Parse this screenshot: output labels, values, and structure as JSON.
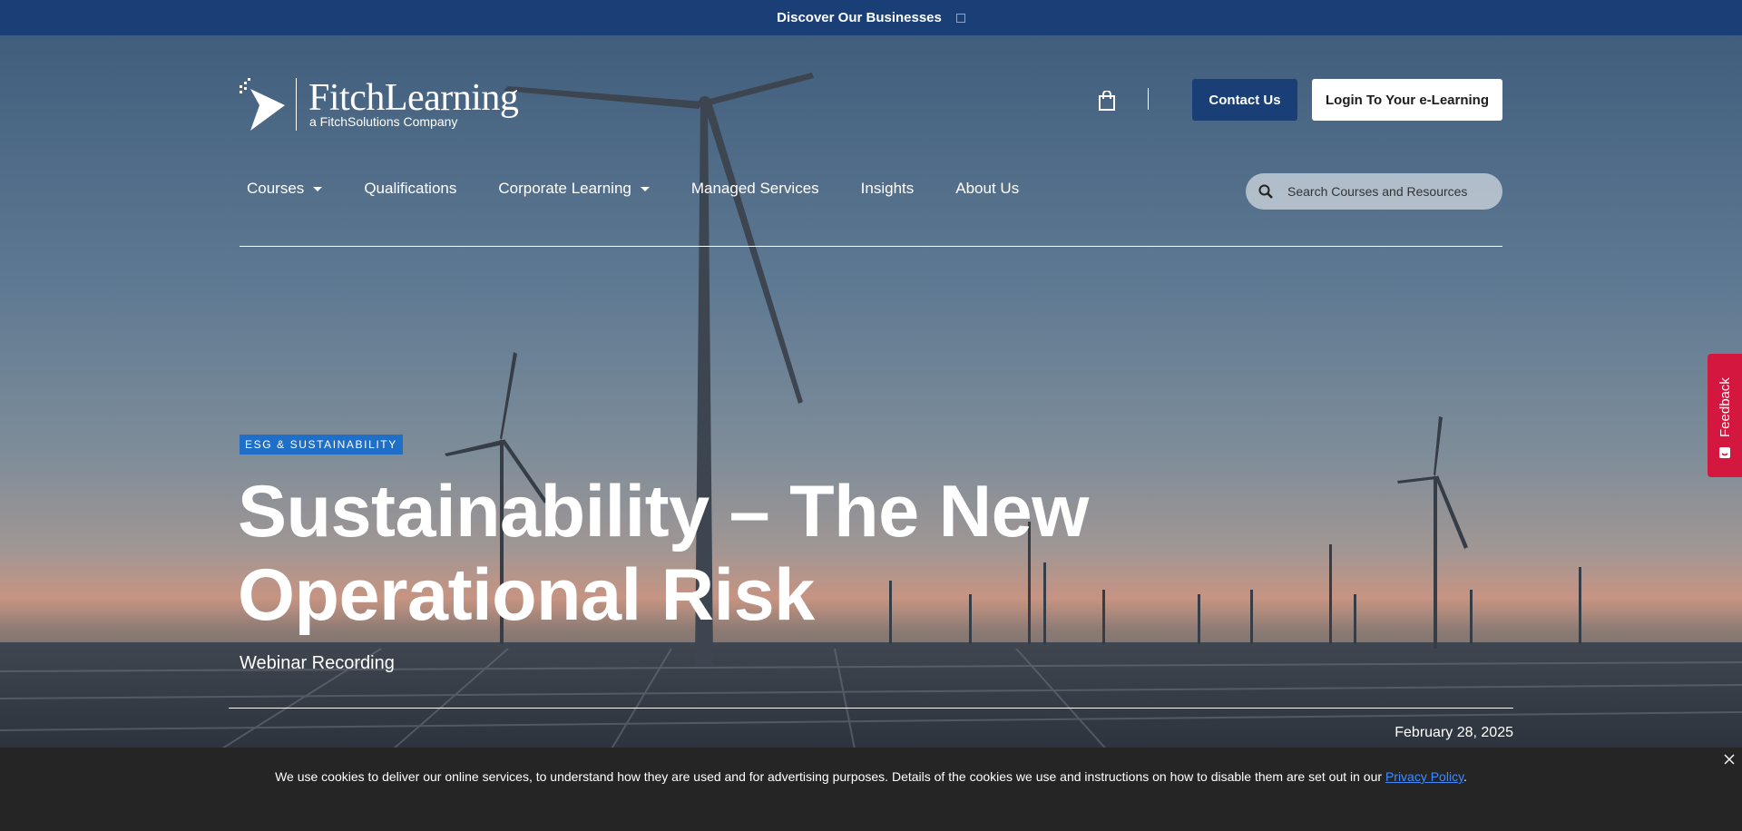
{
  "banner": {
    "label": "Discover Our Businesses"
  },
  "logo": {
    "brand": "FitchLearning",
    "sub": "a FitchSolutions Company"
  },
  "header": {
    "contact_label": "Contact Us",
    "login_label": "Login To Your e-Learning",
    "cart_icon": "shopping-bag-icon"
  },
  "nav": {
    "items": [
      {
        "label": "Courses",
        "has_dropdown": true
      },
      {
        "label": "Qualifications",
        "has_dropdown": false
      },
      {
        "label": "Corporate Learning",
        "has_dropdown": true
      },
      {
        "label": "Managed Services",
        "has_dropdown": false
      },
      {
        "label": "Insights",
        "has_dropdown": false
      },
      {
        "label": "About Us",
        "has_dropdown": false
      }
    ]
  },
  "search": {
    "placeholder": "Search Courses and Resources",
    "icon": "search-icon"
  },
  "hero": {
    "tag": "ESG & SUSTAINABILITY",
    "title": "Sustainability – The New Operational Risk",
    "subtitle": "Webinar Recording",
    "date": "February 28, 2025"
  },
  "feedback": {
    "label": "Feedback"
  },
  "cookie": {
    "message": "We use cookies to deliver our online services, to understand how they are used and for advertising purposes. Details of the cookies we use and instructions on how to disable them are set out in our ",
    "link_label": "Privacy Policy",
    "suffix": "."
  },
  "colors": {
    "brand_navy": "#1a3f77",
    "tag_blue": "#1f6fc9",
    "feedback_red": "#d4173e",
    "cookie_bg": "#252525"
  }
}
